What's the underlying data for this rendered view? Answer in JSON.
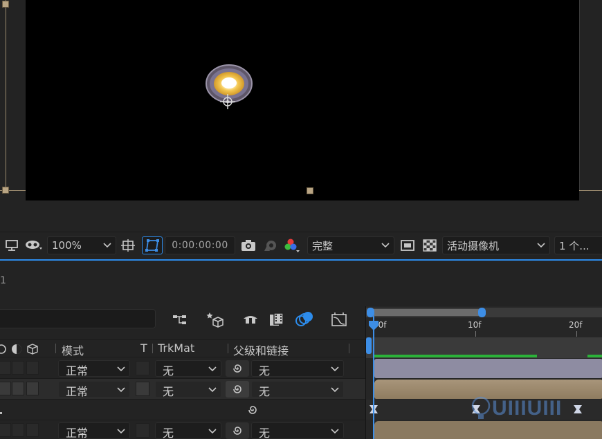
{
  "viewer": {
    "zoom": "100%",
    "timecode": "0:00:00:00",
    "resolution": "完整",
    "camera": "活动摄像机",
    "views": "1 个..."
  },
  "timeline": {
    "comp_tab_number": "1",
    "columns": {
      "mode": "模式",
      "t": "T",
      "trkmat": "TrkMat",
      "parent": "父级和链接"
    },
    "layers": [
      {
        "mode": "正常",
        "trkmat": "无",
        "parent": "无"
      },
      {
        "mode": "正常",
        "trkmat": "无",
        "parent": "无"
      },
      {
        "parent_only": true
      },
      {
        "mode": "正常",
        "trkmat": "无",
        "parent": "无"
      }
    ],
    "ruler": [
      "00f",
      "10f",
      "20f"
    ]
  },
  "colors": {
    "accent": "#2d8ceb",
    "render_bar": "#2bb339",
    "track_lavender": "#8e8ca2",
    "track_tan": "#9f8c6c"
  },
  "watermark": "UIIIUIII"
}
